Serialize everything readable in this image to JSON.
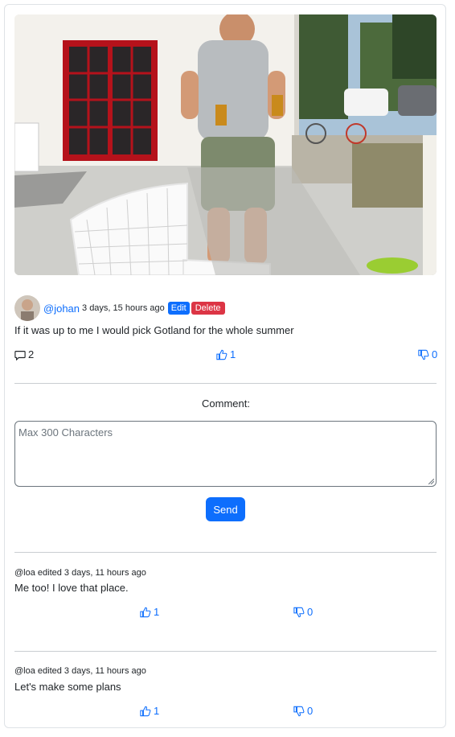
{
  "post": {
    "username": "@johan",
    "time": "3 days, 15 hours ago",
    "edit_label": "Edit",
    "delete_label": "Delete",
    "text": "If it was up to me I would pick Gotland for the whole summer",
    "comment_count": "2",
    "likes": "1",
    "dislikes": "0"
  },
  "comment_form": {
    "label": "Comment:",
    "placeholder": "Max 300 Characters",
    "send_label": "Send"
  },
  "comments": [
    {
      "meta": "@loa edited 3 days, 11 hours ago",
      "text": "Me too! I love that place.",
      "likes": "1",
      "dislikes": "0"
    },
    {
      "meta": "@loa edited 3 days, 11 hours ago",
      "text": "Let's make some plans",
      "likes": "1",
      "dislikes": "0"
    }
  ],
  "colors": {
    "primary": "#0d6efd",
    "danger": "#dc3545"
  },
  "icons": [
    "comment-icon",
    "thumbs-up-icon",
    "thumbs-down-icon"
  ]
}
